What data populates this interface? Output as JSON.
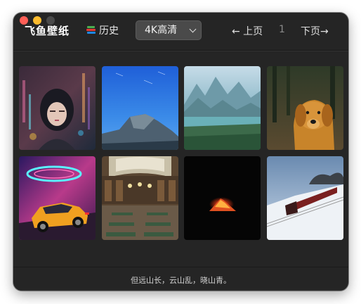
{
  "app": {
    "title": "飞鱼壁纸"
  },
  "toolbar": {
    "history_label": "历史",
    "quality_selected": "4K高清",
    "prev_label": "← 上页",
    "page_number": "1",
    "next_label": "下页→"
  },
  "wallpapers": [
    {
      "subject": "cyberpunk girl"
    },
    {
      "subject": "half dome starry sky"
    },
    {
      "subject": "misty mountain lake"
    },
    {
      "subject": "golden retriever"
    },
    {
      "subject": "orange sports car"
    },
    {
      "subject": "library hall"
    },
    {
      "subject": "erupting volcano night"
    },
    {
      "subject": "steam train in snow"
    }
  ],
  "footer": {
    "quote": "但远山长，云山乱，晓山青。"
  }
}
